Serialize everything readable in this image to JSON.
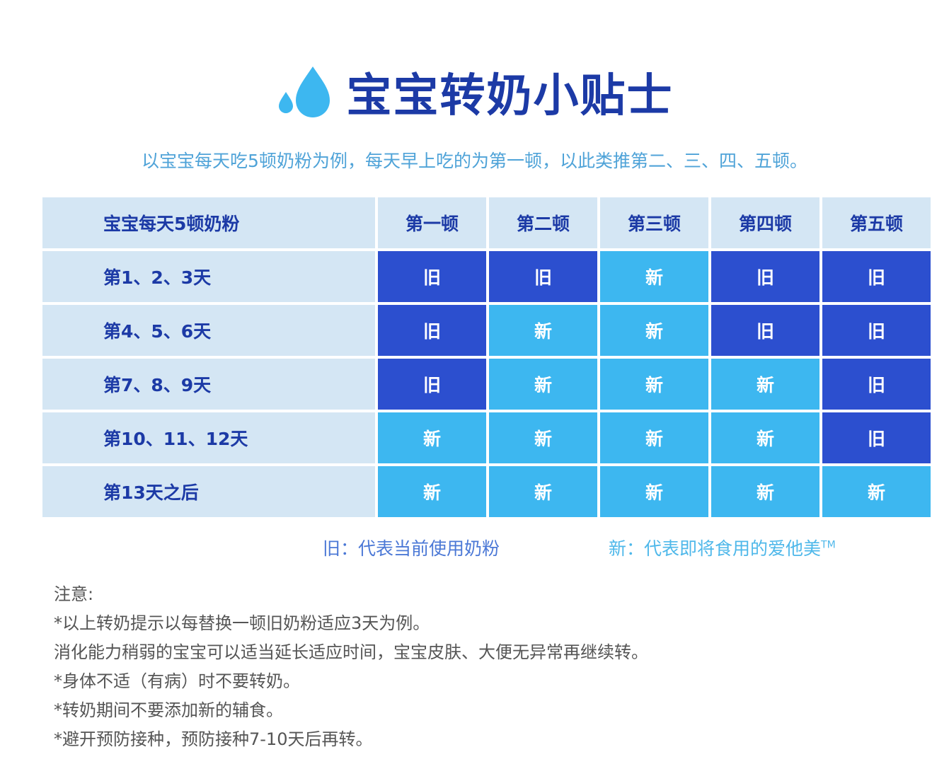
{
  "title": "宝宝转奶小贴士",
  "subtitle": "以宝宝每天吃5顿奶粉为例，每天早上吃的为第一顿，以此类推第二、三、四、五顿。",
  "colors": {
    "old": "#2c4fcf",
    "new": "#3db7f0",
    "header_bg": "#d4e6f4",
    "title": "#1c3aa6",
    "drop": "#3db7f0"
  },
  "icons": [
    "water-drop-icon"
  ],
  "table": {
    "corner": "宝宝每天5顿奶粉",
    "columns": [
      "第一顿",
      "第二顿",
      "第三顿",
      "第四顿",
      "第五顿"
    ],
    "rows": [
      {
        "label": "第1、2、3天",
        "cells": [
          "旧",
          "旧",
          "新",
          "旧",
          "旧"
        ]
      },
      {
        "label": "第4、5、6天",
        "cells": [
          "旧",
          "新",
          "新",
          "旧",
          "旧"
        ]
      },
      {
        "label": "第7、8、9天",
        "cells": [
          "旧",
          "新",
          "新",
          "新",
          "旧"
        ]
      },
      {
        "label": "第10、11、12天",
        "cells": [
          "新",
          "新",
          "新",
          "新",
          "旧"
        ]
      },
      {
        "label": "第13天之后",
        "cells": [
          "新",
          "新",
          "新",
          "新",
          "新"
        ]
      }
    ]
  },
  "legend": {
    "old": "旧：代表当前使用奶粉",
    "new": "新：代表即将食用的爱他美",
    "tm": "TM"
  },
  "notes": [
    "注意:",
    "*以上转奶提示以每替换一顿旧奶粉适应3天为例。",
    " 消化能力稍弱的宝宝可以适当延长适应时间，宝宝皮肤、大便无异常再继续转。",
    "*身体不适（有病）时不要转奶。",
    "*转奶期间不要添加新的辅食。",
    "*避开预防接种，预防接种7-10天后再转。"
  ]
}
